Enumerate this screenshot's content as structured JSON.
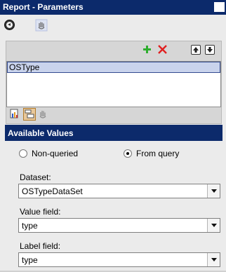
{
  "window": {
    "title": "Report - Parameters"
  },
  "toolbar": {
    "back_icon": "back-icon",
    "hand_icon": "hand-icon"
  },
  "parameters": {
    "items": [
      "OSType"
    ],
    "actions": {
      "add_icon": "plus-icon",
      "remove_icon": "x-icon",
      "move_up_icon": "arrow-up-icon",
      "move_down_icon": "arrow-down-icon"
    }
  },
  "available_values": {
    "header": "Available Values",
    "option_nonqueried": "Non-queried",
    "option_fromquery": "From query",
    "selected": "From query",
    "dataset_label": "Dataset:",
    "dataset_value": "OSTypeDataSet",
    "value_field_label": "Value field:",
    "value_field_value": "type",
    "label_field_label": "Label field:",
    "label_field_value": "type"
  }
}
